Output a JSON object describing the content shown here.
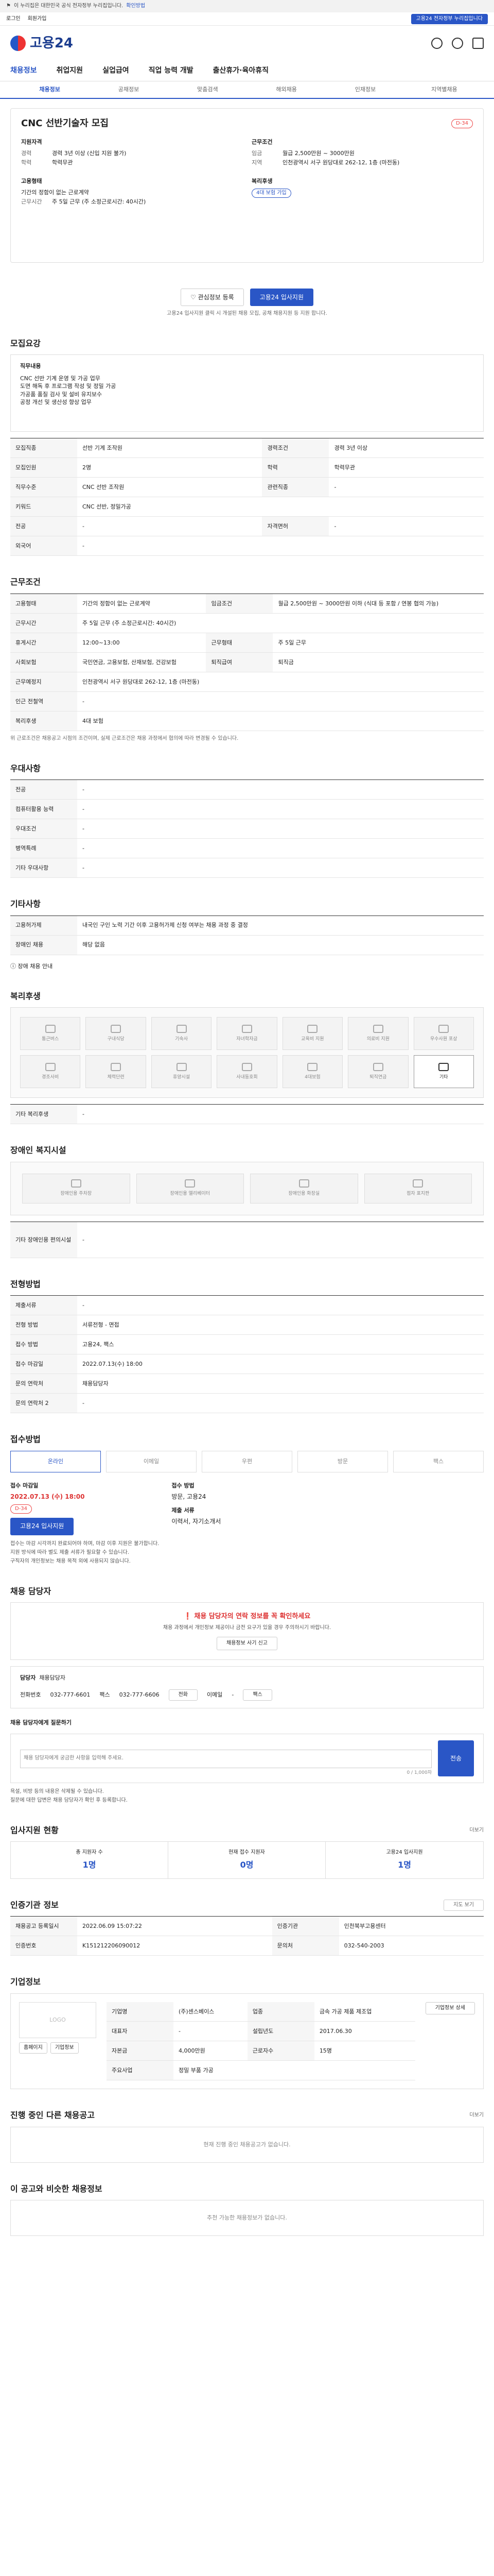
{
  "gov_bar": {
    "text": "이 누리집은 대한민국 공식 전자정부 누리집입니다.",
    "toggle": "확인방법"
  },
  "util": {
    "link1": "로그인",
    "link2": "회원가입",
    "link3": "기업",
    "pill": "고용24 전자정부 누리집입니다"
  },
  "header": {
    "logo_text": "고용24"
  },
  "gnb": [
    "채용정보",
    "취업지원",
    "실업급여",
    "직업 능력 개발",
    "출산휴가·육아휴직"
  ],
  "lnb": [
    "채용정보",
    "공채정보",
    "맞춤검색",
    "해외채용",
    "인재정보",
    "지역별채용"
  ],
  "job": {
    "title": "CNC 선반기술자 모집",
    "badge": "D-34",
    "company_h": "지원자격",
    "condition_h": "근무조건",
    "edu_k": "경력",
    "edu_v": "경력 3년 이상 (신입 지원 불가)",
    "grade_k": "학력",
    "grade_v": "학력무관",
    "wage_k": "임금",
    "wage_v": "월급 2,500만원 ~ 3000만원",
    "loc_k": "지역",
    "loc_v": "인천광역시 서구 원당대로 262-12, 1층 (마전동)",
    "type_h": "고용형태",
    "type_v": "기간의 정함이 없는 근로계약",
    "time_k": "근무시간",
    "time_v": "주 5일 근무 (주 소정근로시간: 40시간)",
    "benefit_h": "복리후생",
    "benefit_v": "4대 보험 가입",
    "btn_scrap": "관심정보 등록",
    "btn_apply": "고용24 입사지원",
    "note": "고용24 입사지원 클릭 시 개설된 채용 모집, 공채 채용지원 등 지원 합니다."
  },
  "recruit": {
    "h": "모집요강",
    "duty_h": "직무내용",
    "duty_lines": [
      "CNC 선반 기계 운영 및 가공 업무",
      "도면 해독 후 프로그램 작성 및 정밀 가공",
      "가공품 품질 검사 및 설비 유지보수",
      "공정 개선 및 생산성 향상 업무"
    ],
    "rows": [
      [
        "모집직종",
        "선반 기계 조작원",
        "경력조건",
        "경력 3년 이상"
      ],
      [
        "모집인원",
        "2명",
        "학력",
        "학력무관"
      ],
      [
        "직무수준",
        "CNC 선반 조작원",
        "관련직종",
        "-"
      ],
      [
        "키워드",
        "CNC 선반, 정밀가공",
        "",
        ""
      ],
      [
        "전공",
        "-",
        "자격면허",
        "-"
      ],
      [
        "외국어",
        "-",
        "",
        ""
      ]
    ]
  },
  "work": {
    "h": "근무조건",
    "rows": [
      [
        "고용형태",
        "기간의 정함이 없는 근로계약",
        "임금조건",
        "월급 2,500만원 ~ 3000만원 이하\n(식대 등 포함 / 연봉 협의 가능)"
      ],
      [
        "근무시간",
        "주 5일 근무 (주 소정근로시간: 40시간)",
        "",
        ""
      ],
      [
        "휴게시간",
        "12:00~13:00",
        "근무형태",
        "주 5일 근무"
      ],
      [
        "사회보험",
        "국민연금, 고용보험, 산재보험, 건강보험",
        "퇴직급여",
        "퇴직금"
      ],
      [
        "근무예정지",
        "인천광역시 서구 원당대로 262-12, 1층 (마전동)",
        "",
        ""
      ],
      [
        "인근 전철역",
        "-",
        "",
        ""
      ],
      [
        "복리후생",
        "4대 보험",
        "",
        ""
      ]
    ],
    "map_btn": "지도 보기",
    "note": "위 근로조건은 채용공고 시점의 조건이며, 실제 근로조건은 채용 과정에서 협의에 따라 변경될 수 있습니다."
  },
  "prefer": {
    "h": "우대사항",
    "rows": [
      [
        "전공",
        "-"
      ],
      [
        "컴퓨터활용 능력",
        "-"
      ],
      [
        "우대조건",
        "-"
      ],
      [
        "병역특례",
        "-"
      ],
      [
        "기타 우대사항",
        "-"
      ]
    ]
  },
  "etc": {
    "h": "기타사항",
    "rows": [
      [
        "고용허가제",
        "내국인 구인 노력 기간 이후 고용허가제 신청 여부는 채용 과정 중 결정"
      ],
      [
        "장애인 채용",
        "해당 없음"
      ]
    ],
    "link": "장애 채용 안내"
  },
  "welfare": {
    "h": "복리후생",
    "items": [
      "통근버스",
      "구내식당",
      "기숙사",
      "자녀학자금",
      "교육비 지원",
      "의료비 지원",
      "우수사원 포상",
      "경조사비",
      "체력단련",
      "휴양시설",
      "사내동호회",
      "4대보험",
      "퇴직연금",
      "기타"
    ],
    "on_index": 13,
    "etc_k": "기타 복리후생",
    "etc_v": "-"
  },
  "disabled": {
    "h": "장애인 복지시설",
    "items": [
      "장애인용 주차장",
      "장애인용 엘리베이터",
      "장애인용 화장실",
      "점자 표지판"
    ],
    "etc_k": "기타 장애인용 편의시설",
    "etc_v": "-"
  },
  "process": {
    "h": "전형방법",
    "rows": [
      [
        "제출서류",
        "-"
      ],
      [
        "전형 방법",
        "서류전형 - 면접"
      ],
      [
        "접수 방법",
        "고용24, 팩스"
      ],
      [
        "접수 마감일",
        "2022.07.13(수) 18:00"
      ],
      [
        "문의 연락처",
        "채용담당자"
      ],
      [
        "문의 연락처 2",
        "-"
      ]
    ]
  },
  "apply": {
    "h": "접수방법",
    "methods": [
      "온라인",
      "이메일",
      "우편",
      "방문",
      "팩스"
    ],
    "on_index": 0,
    "period_h": "접수 마감일",
    "period_v": "2022.07.13 (수) 18:00",
    "badge": "D-34",
    "btn": "고용24 입사지원",
    "method_h": "접수 방법",
    "method_v": "방문, 고용24",
    "doc_h": "제출 서류",
    "doc_v": "이력서, 자기소개서",
    "notes": [
      "접수는 마감 시각까지 완료되어야 하며, 마감 이후 지원은 불가합니다.",
      "지원 방식에 따라 별도 제출 서류가 필요할 수 있습니다.",
      "구직자의 개인정보는 채용 목적 외에 사용되지 않습니다."
    ]
  },
  "contact": {
    "h": "채용 담당자",
    "warn_title": "채용 담당자의 연락 정보를 꼭 확인하세요",
    "warn_text": "채용 과정에서 개인정보 제공이나 금전 요구가 있을 경우 주의하시기 바랍니다.",
    "warn_btn": "채용정보 사기 신고",
    "person_k": "담당자",
    "person_v": "채용담당자",
    "phone_k": "전화번호",
    "phone_v": "032-777-6601",
    "fax_k": "팩스",
    "fax_v": "032-777-6606",
    "email_k": "이메일",
    "email_v": "-",
    "btn_call": "전화",
    "btn_fax": "팩스"
  },
  "question": {
    "h": "채용 담당자에게 질문하기",
    "placeholder": "채용 담당자에게 궁금한 사항을 입력해 주세요.",
    "count": "0 / 1,000자",
    "btn": "전송",
    "notes": [
      "욕설, 비방 등의 내용은 삭제될 수 있습니다.",
      "질문에 대한 답변은 채용 담당자가 확인 후 등록합니다."
    ]
  },
  "stats": {
    "h": "입사지원 현황",
    "more": "더보기",
    "items": [
      {
        "label": "총 지원자 수",
        "value": "1명"
      },
      {
        "label": "현재 접수 지원자",
        "value": "0명"
      },
      {
        "label": "고용24 입사지원",
        "value": "1명"
      }
    ]
  },
  "org": {
    "h": "인증기관 정보",
    "rows": [
      [
        "채용공고 등록일시",
        "2022.06.09 15:07:22",
        "인증기관",
        "인천북부고용센터"
      ],
      [
        "인증번호",
        "K151212206090012",
        "문의처",
        "032-540-2003"
      ]
    ],
    "map_btn": "지도 보기"
  },
  "company": {
    "h": "기업정보",
    "logo": "LOGO",
    "btn_home": "홈페이지",
    "btn_more": "기업정보",
    "rows": [
      [
        "기업명",
        "(주)센스베이스",
        "업종",
        "금속 가공 제품 제조업"
      ],
      [
        "대표자",
        "-",
        "설립년도",
        "2017.06.30"
      ],
      [
        "자본금",
        "4,000만원",
        "근로자수",
        "15명"
      ],
      [
        "주요사업",
        "정밀 부품 가공",
        "",
        ""
      ]
    ],
    "btn_detail": "기업정보 상세"
  },
  "same_company": {
    "h": "진행 중인 다른 채용공고",
    "more": "더보기",
    "empty": "현재 진행 중인 채용공고가 없습니다."
  },
  "recommend": {
    "h": "이 공고와 비슷한 채용정보",
    "empty": "추천 가능한 채용정보가 없습니다."
  }
}
